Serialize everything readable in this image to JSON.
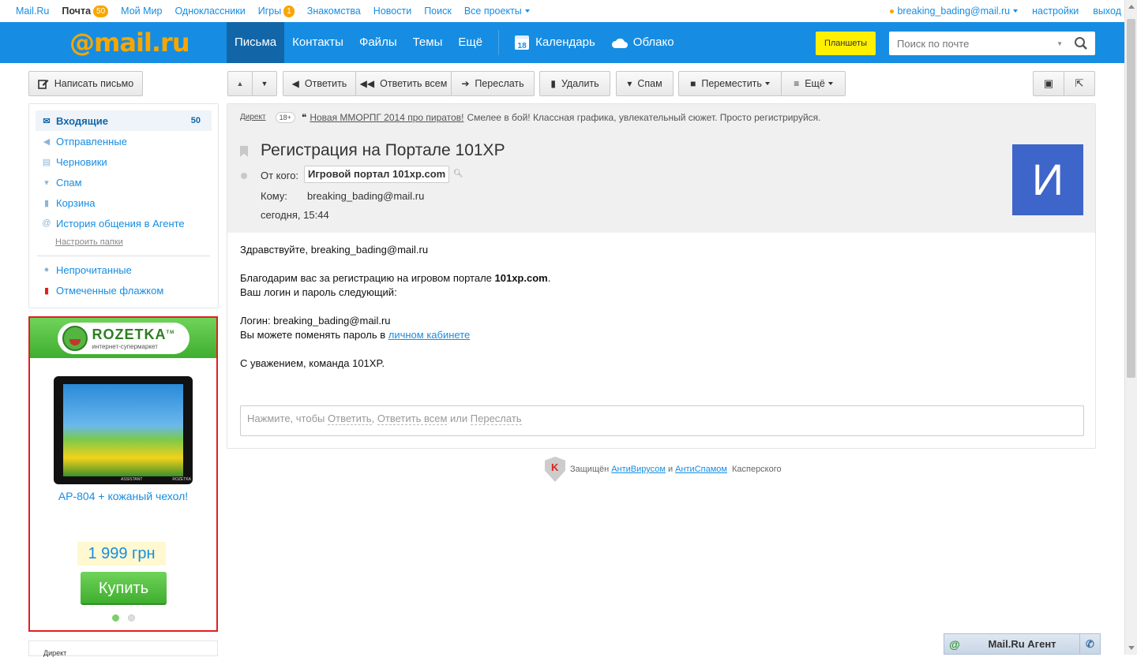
{
  "portal": {
    "items": [
      "Mail.Ru",
      "Почта",
      "Мой Мир",
      "Одноклассники",
      "Игры",
      "Знакомства",
      "Новости",
      "Поиск",
      "Все проекты"
    ],
    "mail_count": "50",
    "games_count": "1",
    "user": "breaking_bading@mail.ru",
    "settings": "настройки",
    "logout": "выход"
  },
  "header": {
    "logo": "@mail.ru",
    "nav": [
      "Письма",
      "Контакты",
      "Файлы",
      "Темы",
      "Ещё"
    ],
    "calendar": "Календарь",
    "calendar_day": "18",
    "cloud": "Облако",
    "tablets": "Планшеты",
    "search_placeholder": "Поиск по почте"
  },
  "toolbar": {
    "compose": "Написать письмо",
    "reply": "Ответить",
    "reply_all": "Ответить всем",
    "forward": "Переслать",
    "delete": "Удалить",
    "spam": "Спам",
    "move": "Переместить",
    "more": "Ещё"
  },
  "folders": {
    "items": [
      {
        "label": "Входящие",
        "count": "50"
      },
      {
        "label": "Отправленные"
      },
      {
        "label": "Черновики"
      },
      {
        "label": "Спам"
      },
      {
        "label": "Корзина"
      },
      {
        "label": "История общения в Агенте"
      }
    ],
    "configure": "Настроить папки",
    "unread": "Непрочитанные",
    "flagged": "Отмеченные флажком"
  },
  "ad": {
    "brand": "ROZETKA",
    "brand_tm": "TM",
    "brand_sub": "интернет-супермаркет",
    "device_brand": "ASSISTANT",
    "device_brand2": "ROZETKA",
    "title": "AP-804 + кожаный чехол!",
    "price": "1 999 грн",
    "buy": "Купить",
    "below": "Директ"
  },
  "direct": {
    "label": "Директ",
    "age": "18+",
    "link": "Новая ММОРПГ 2014 про пиратов!",
    "text": "Смелее в бой! Классная графика, увлекательный сюжет. Просто регистрируйся."
  },
  "message": {
    "subject": "Регистрация на Портале 101XP",
    "from_label": "От кого:",
    "from": "Игровой портал 101xp.com",
    "to_label": "Кому:",
    "to": "breaking_bading@mail.ru",
    "date": "сегодня, 15:44",
    "avatar_letter": "И",
    "body": {
      "greeting": "Здравствуйте, breaking_bading@mail.ru",
      "thanks": "Благодарим вас за регистрацию на игровом портале ",
      "site": "101xp.com",
      "thanks_end": ".",
      "creds_intro": "Ваш логин и пароль следующий:",
      "login": "Логин: breaking_bading@mail.ru",
      "change": "Вы можете поменять пароль в ",
      "cabinet": "личном кабинете",
      "regards": "С уважением, команда 101XP."
    }
  },
  "quick_reply": {
    "prefix": "Нажмите, чтобы ",
    "reply": "Ответить",
    "comma": ", ",
    "reply_all": "Ответить всем",
    "or": " или ",
    "forward": "Переслать"
  },
  "kaspersky": {
    "prefix": "Защищён",
    "antivirus": "АнтиВирусом",
    "and": "и",
    "antispam": "АнтиСпамом",
    "suffix": "Касперского"
  },
  "agent": {
    "title": "Mail.Ru Агент"
  },
  "colors": {
    "brand_blue": "#168de2",
    "accent_orange": "#f7a600",
    "tablets_yellow": "#fff000",
    "avatar": "#3e65c9",
    "ad_green": "#3fae2f",
    "ad_border": "#e02020"
  }
}
